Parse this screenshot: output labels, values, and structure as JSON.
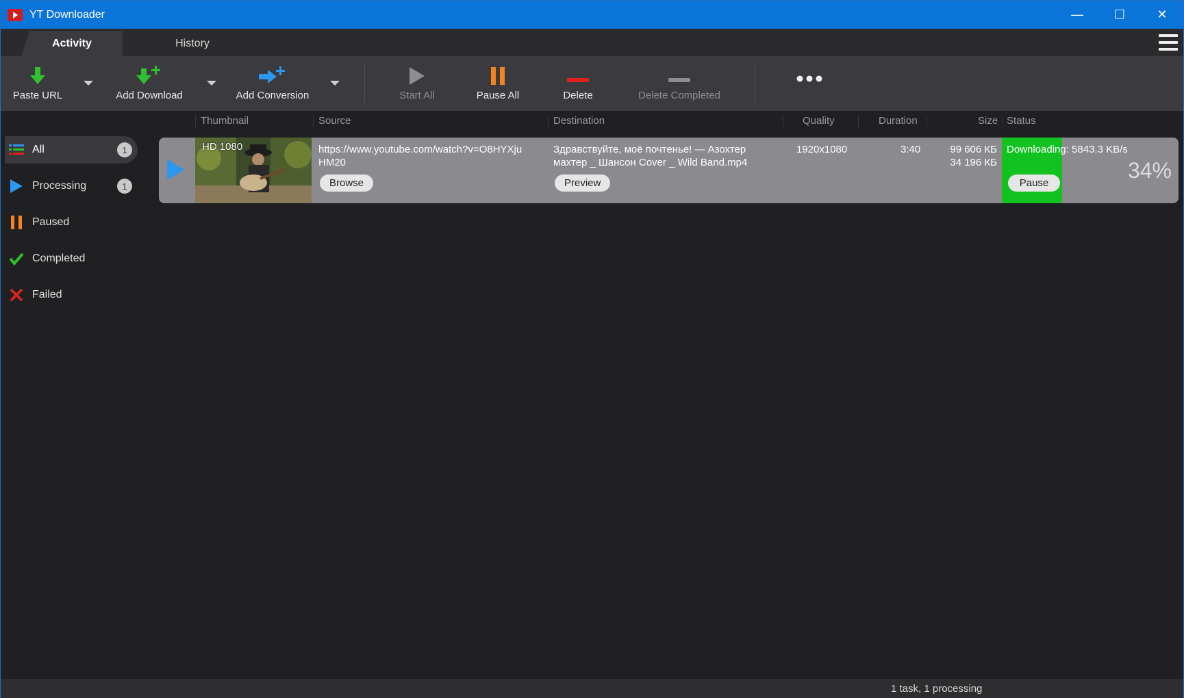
{
  "app": {
    "title": "YT Downloader"
  },
  "window_controls": {
    "minimize": "—",
    "maximize": "☐",
    "close": "✕"
  },
  "tabs": [
    {
      "label": "Activity",
      "active": true
    },
    {
      "label": "History",
      "active": false
    }
  ],
  "toolbar": {
    "paste_url": "Paste URL",
    "add_download": "Add Download",
    "add_conversion": "Add Conversion",
    "start_all": "Start All",
    "pause_all": "Pause All",
    "delete": "Delete",
    "delete_completed": "Delete Completed",
    "more_icon": "more-dots-icon"
  },
  "columns": {
    "thumbnail": "Thumbnail",
    "source": "Source",
    "destination": "Destination",
    "quality": "Quality",
    "duration": "Duration",
    "size": "Size",
    "status": "Status"
  },
  "sidebar": {
    "items": [
      {
        "label": "All",
        "count": "1",
        "icon": "list-icon"
      },
      {
        "label": "Processing",
        "count": "1",
        "icon": "play-icon"
      },
      {
        "label": "Paused",
        "icon": "pause-icon"
      },
      {
        "label": "Completed",
        "icon": "check-icon"
      },
      {
        "label": "Failed",
        "icon": "cross-icon"
      }
    ]
  },
  "download": {
    "thumb_label": "HD 1080",
    "source_url": "https://www.youtube.com/watch?v=O8HYXju HM20",
    "source_line1": "https://www.youtube.com/watch?v=O8HYXju",
    "source_line2": "HM20",
    "browse": "Browse",
    "destination_line1": "Здравствуйте, моё почтенье! — Азохтер",
    "destination_line2": "махтер _ Шансон Cover _ Wild Band.mp4",
    "preview": "Preview",
    "quality": "1920x1080",
    "duration": "3:40",
    "size_total": "99 606 КБ",
    "size_done": "34 196 КБ",
    "status_text": "Downloading: 5843.3 KB/s",
    "pause": "Pause",
    "progress_percent": "34%",
    "progress": 0.34
  },
  "colors": {
    "titlebar": "#0a74d8",
    "progress_green": "#11c220",
    "play_blue": "#2b97ef",
    "pause_orange": "#f5841f",
    "delete_red": "#e2231a"
  },
  "statusbar": {
    "text": "1 task, 1 processing"
  }
}
